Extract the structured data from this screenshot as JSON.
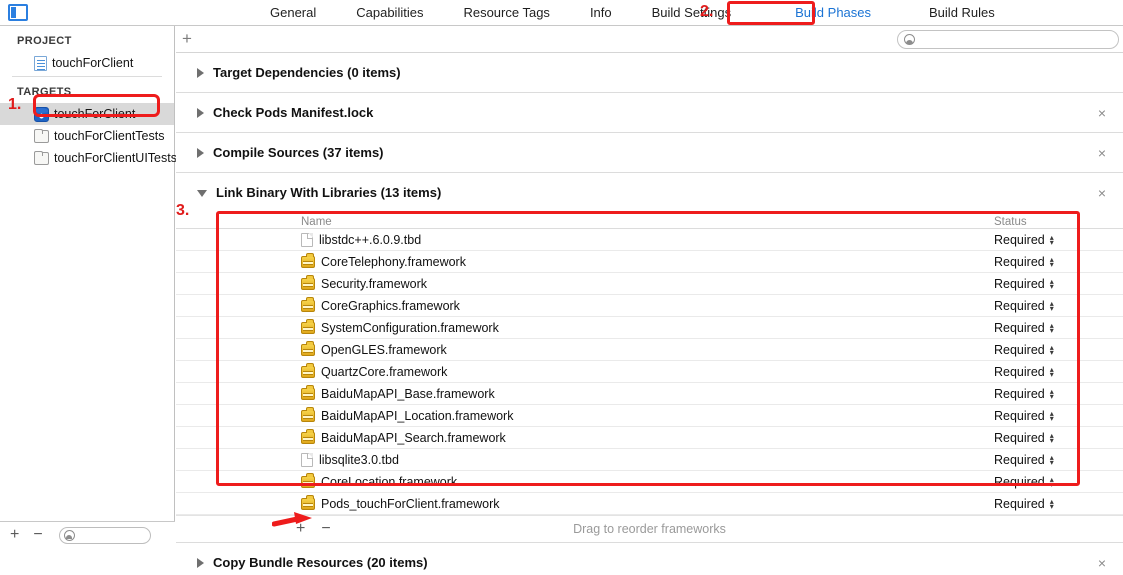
{
  "window": {
    "panel_toggle_icon": "left-panel-toggle-icon"
  },
  "tabbar": {
    "tabs": [
      {
        "label": "General",
        "selected": false
      },
      {
        "label": "Capabilities",
        "selected": false
      },
      {
        "label": "Resource Tags",
        "selected": false
      },
      {
        "label": "Info",
        "selected": false
      },
      {
        "label": "Build Settings",
        "selected": false
      },
      {
        "label": "Build Phases",
        "selected": true
      },
      {
        "label": "Build Rules",
        "selected": false
      }
    ]
  },
  "sidebar": {
    "project_label": "PROJECT",
    "project_items": [
      {
        "label": "touchForClient",
        "icon": "project-document-icon"
      }
    ],
    "targets_label": "TARGETS",
    "target_items": [
      {
        "label": "touchForClient",
        "icon": "app-target-icon",
        "selected": true
      },
      {
        "label": "touchForClientTests",
        "icon": "test-target-icon",
        "selected": false
      },
      {
        "label": "touchForClientUITests",
        "icon": "test-target-icon",
        "selected": false
      }
    ],
    "footer": {
      "add_label": "+",
      "remove_label": "−",
      "filter_placeholder": ""
    }
  },
  "main": {
    "add_phase_label": "+",
    "search_placeholder": "",
    "phases": [
      {
        "title": "Target Dependencies (0 items)",
        "expanded": false,
        "removable": false
      },
      {
        "title": "Check Pods Manifest.lock",
        "expanded": false,
        "removable": true,
        "remove_label": "×"
      },
      {
        "title": "Compile Sources (37 items)",
        "expanded": false,
        "removable": true,
        "remove_label": "×"
      },
      {
        "title": "Link Binary With Libraries (13 items)",
        "expanded": true,
        "removable": true,
        "remove_label": "×"
      },
      {
        "title": "Copy Bundle Resources (20 items)",
        "expanded": false,
        "removable": true,
        "remove_label": "×"
      }
    ],
    "link_binary": {
      "columns": {
        "name": "Name",
        "status": "Status"
      },
      "rows": [
        {
          "name": "libstdc++.6.0.9.tbd",
          "icon": "tbd-file-icon",
          "status": "Required"
        },
        {
          "name": "CoreTelephony.framework",
          "icon": "framework-icon",
          "status": "Required"
        },
        {
          "name": "Security.framework",
          "icon": "framework-icon",
          "status": "Required"
        },
        {
          "name": "CoreGraphics.framework",
          "icon": "framework-icon",
          "status": "Required"
        },
        {
          "name": "SystemConfiguration.framework",
          "icon": "framework-icon",
          "status": "Required"
        },
        {
          "name": "OpenGLES.framework",
          "icon": "framework-icon",
          "status": "Required"
        },
        {
          "name": "QuartzCore.framework",
          "icon": "framework-icon",
          "status": "Required"
        },
        {
          "name": "BaiduMapAPI_Base.framework",
          "icon": "framework-icon",
          "status": "Required"
        },
        {
          "name": "BaiduMapAPI_Location.framework",
          "icon": "framework-icon",
          "status": "Required"
        },
        {
          "name": "BaiduMapAPI_Search.framework",
          "icon": "framework-icon",
          "status": "Required"
        },
        {
          "name": "libsqlite3.0.tbd",
          "icon": "tbd-file-icon",
          "status": "Required"
        },
        {
          "name": "CoreLocation.framework",
          "icon": "framework-icon",
          "status": "Required"
        },
        {
          "name": "Pods_touchForClient.framework",
          "icon": "framework-icon",
          "status": "Required"
        }
      ],
      "footer": {
        "add_label": "+",
        "remove_label": "−",
        "hint": "Drag to reorder frameworks"
      }
    }
  },
  "annotations": {
    "marker_1": "1.",
    "marker_2": "2.",
    "marker_3": "3.",
    "highlight_color": "#ee1c1c",
    "arrow": "red-arrow-pointing-to-add-framework-button"
  }
}
